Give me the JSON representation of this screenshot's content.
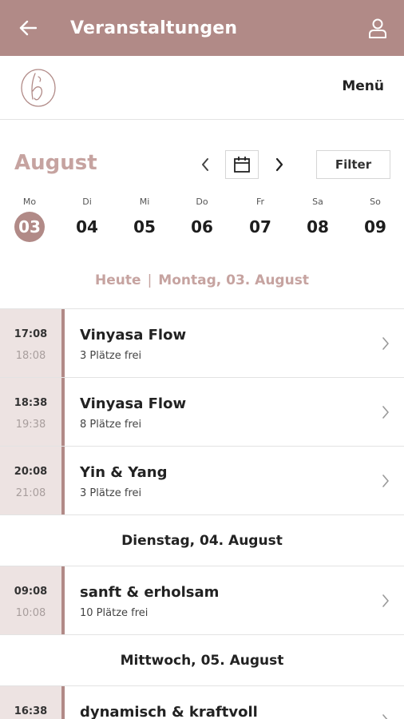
{
  "appbar": {
    "title": "Veranstaltungen",
    "back_icon": "arrow-left-icon",
    "user_icon": "user-icon"
  },
  "logobar": {
    "menu_label": "Menü",
    "logo_icon": "studio-logo"
  },
  "calendar": {
    "month": "August",
    "filter_label": "Filter",
    "days": [
      {
        "name": "Mo",
        "date": "03",
        "selected": true
      },
      {
        "name": "Di",
        "date": "04",
        "selected": false
      },
      {
        "name": "Mi",
        "date": "05",
        "selected": false
      },
      {
        "name": "Do",
        "date": "06",
        "selected": false
      },
      {
        "name": "Fr",
        "date": "07",
        "selected": false
      },
      {
        "name": "Sa",
        "date": "08",
        "selected": false
      },
      {
        "name": "So",
        "date": "09",
        "selected": false
      }
    ]
  },
  "today": {
    "label": "Heute",
    "separator": "|",
    "date": "Montag, 03. August"
  },
  "groups": [
    {
      "heading": "",
      "events": [
        {
          "start": "17:08",
          "end": "18:08",
          "title": "Vinyasa Flow",
          "spots": "3 Plätze frei"
        },
        {
          "start": "18:38",
          "end": "19:38",
          "title": "Vinyasa Flow",
          "spots": "8 Plätze frei"
        },
        {
          "start": "20:08",
          "end": "21:08",
          "title": "Yin & Yang",
          "spots": "3 Plätze frei"
        }
      ]
    },
    {
      "heading": "Dienstag, 04. August",
      "events": [
        {
          "start": "09:08",
          "end": "10:08",
          "title": "sanft & erholsam",
          "spots": "10 Plätze frei"
        }
      ]
    },
    {
      "heading": "Mittwoch, 05. August",
      "events": [
        {
          "start": "16:38",
          "end": "",
          "title": "dynamisch & kraftvoll",
          "spots": ""
        }
      ]
    }
  ],
  "colors": {
    "accent": "#b18a87",
    "accent_light": "#c6a3a0",
    "time_bg": "#ede3e2"
  }
}
